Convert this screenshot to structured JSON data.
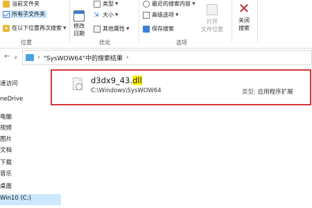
{
  "ribbon": {
    "left": {
      "item1": "当前文件夹",
      "item2": "所有子文件夹",
      "item3": "在以下位置再次搜索",
      "group_label": "位置"
    },
    "refine": {
      "date_modified_line1": "修改",
      "date_modified_line2": "日期",
      "kind": "类型",
      "size": "大小",
      "other_props": "其他属性",
      "group_label": "优化"
    },
    "options": {
      "recent": "最近的搜索内容",
      "advanced": "高级选项",
      "save": "保存搜索",
      "group_label": "选项"
    },
    "open_location_line1": "打开",
    "open_location_line2": "文件位置",
    "close_line1": "关闭",
    "close_line2": "搜索"
  },
  "address": {
    "crumb": "\"SysWOW64\"中的搜索结果"
  },
  "nav": {
    "items": [
      "速访问",
      "neDrive",
      "电脑",
      "视频",
      "图片",
      "文档",
      "下载",
      "音乐",
      "桌面",
      "Win10 (C:)"
    ]
  },
  "result": {
    "name_prefix": "d3dx9_43.",
    "name_highlight": "dll",
    "path": "C:\\Windows\\SysWOW64",
    "type_label": "类型:",
    "type_value": "应用程序扩展"
  },
  "colors": {
    "selection": "#cce8ff",
    "highlight_border": "#d13438",
    "search_highlight": "#fff200"
  }
}
